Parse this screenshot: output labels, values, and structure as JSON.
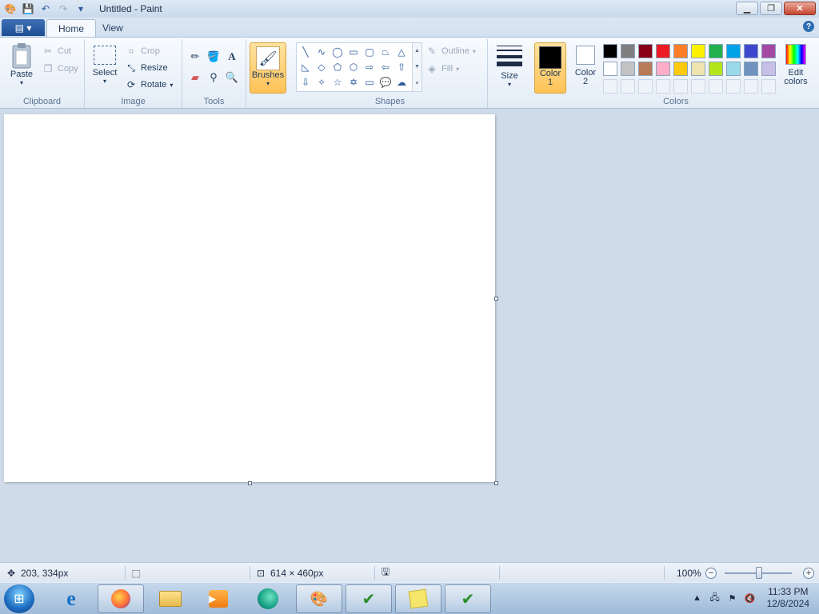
{
  "window": {
    "title": "Untitled - Paint",
    "minimize_icon": "minimize-icon",
    "maximize_icon": "restore-icon",
    "close_icon": "close-icon"
  },
  "qat": {
    "icons": [
      "paint-app-icon",
      "save-icon",
      "undo-icon",
      "redo-icon",
      "customize-dropdown-icon"
    ]
  },
  "tabs": {
    "file_icon": "file-menu-icon",
    "items": [
      "Home",
      "View"
    ],
    "active": "Home"
  },
  "ribbon": {
    "clipboard": {
      "label": "Clipboard",
      "paste": "Paste",
      "cut": "Cut",
      "copy": "Copy"
    },
    "image": {
      "label": "Image",
      "select": "Select",
      "crop": "Crop",
      "resize": "Resize",
      "rotate": "Rotate"
    },
    "tools": {
      "label": "Tools",
      "items": [
        "pencil-icon",
        "fill-icon",
        "text-icon",
        "eraser-icon",
        "color-picker-icon",
        "magnifier-icon"
      ]
    },
    "brushes": {
      "label": "Brushes"
    },
    "shapes": {
      "label": "Shapes",
      "outline": "Outline",
      "fill": "Fill"
    },
    "size": {
      "label": "Size"
    },
    "colors": {
      "label": "Colors",
      "color1": "Color",
      "color1_num": "1",
      "color2": "Color",
      "color2_num": "2",
      "color1_value": "#000000",
      "color2_value": "#ffffff",
      "edit_line1": "Edit",
      "edit_line2": "colors",
      "palette_row1": [
        "#000000",
        "#7f7f7f",
        "#880015",
        "#ed1c24",
        "#ff7f27",
        "#fff200",
        "#22b14c",
        "#00a2e8",
        "#3f48cc",
        "#a349a4"
      ],
      "palette_row2": [
        "#ffffff",
        "#c3c3c3",
        "#b97a57",
        "#ffaec9",
        "#ffc90e",
        "#efe4b0",
        "#b5e61d",
        "#99d9ea",
        "#7092be",
        "#c8bfe7"
      ]
    }
  },
  "status": {
    "cursor_pos": "203, 334px",
    "selection_size": "",
    "canvas_size": "614 × 460px",
    "zoom": "100%"
  },
  "taskbar": {
    "apps": [
      "internet-explorer-icon",
      "firefox-icon",
      "explorer-folder-icon",
      "media-player-icon",
      "edge-like-icon",
      "paint-icon",
      "antivirus-icon",
      "sticky-notes-icon",
      "antivirus-check-icon"
    ],
    "time": "11:33 PM",
    "date": "12/8/2024"
  }
}
